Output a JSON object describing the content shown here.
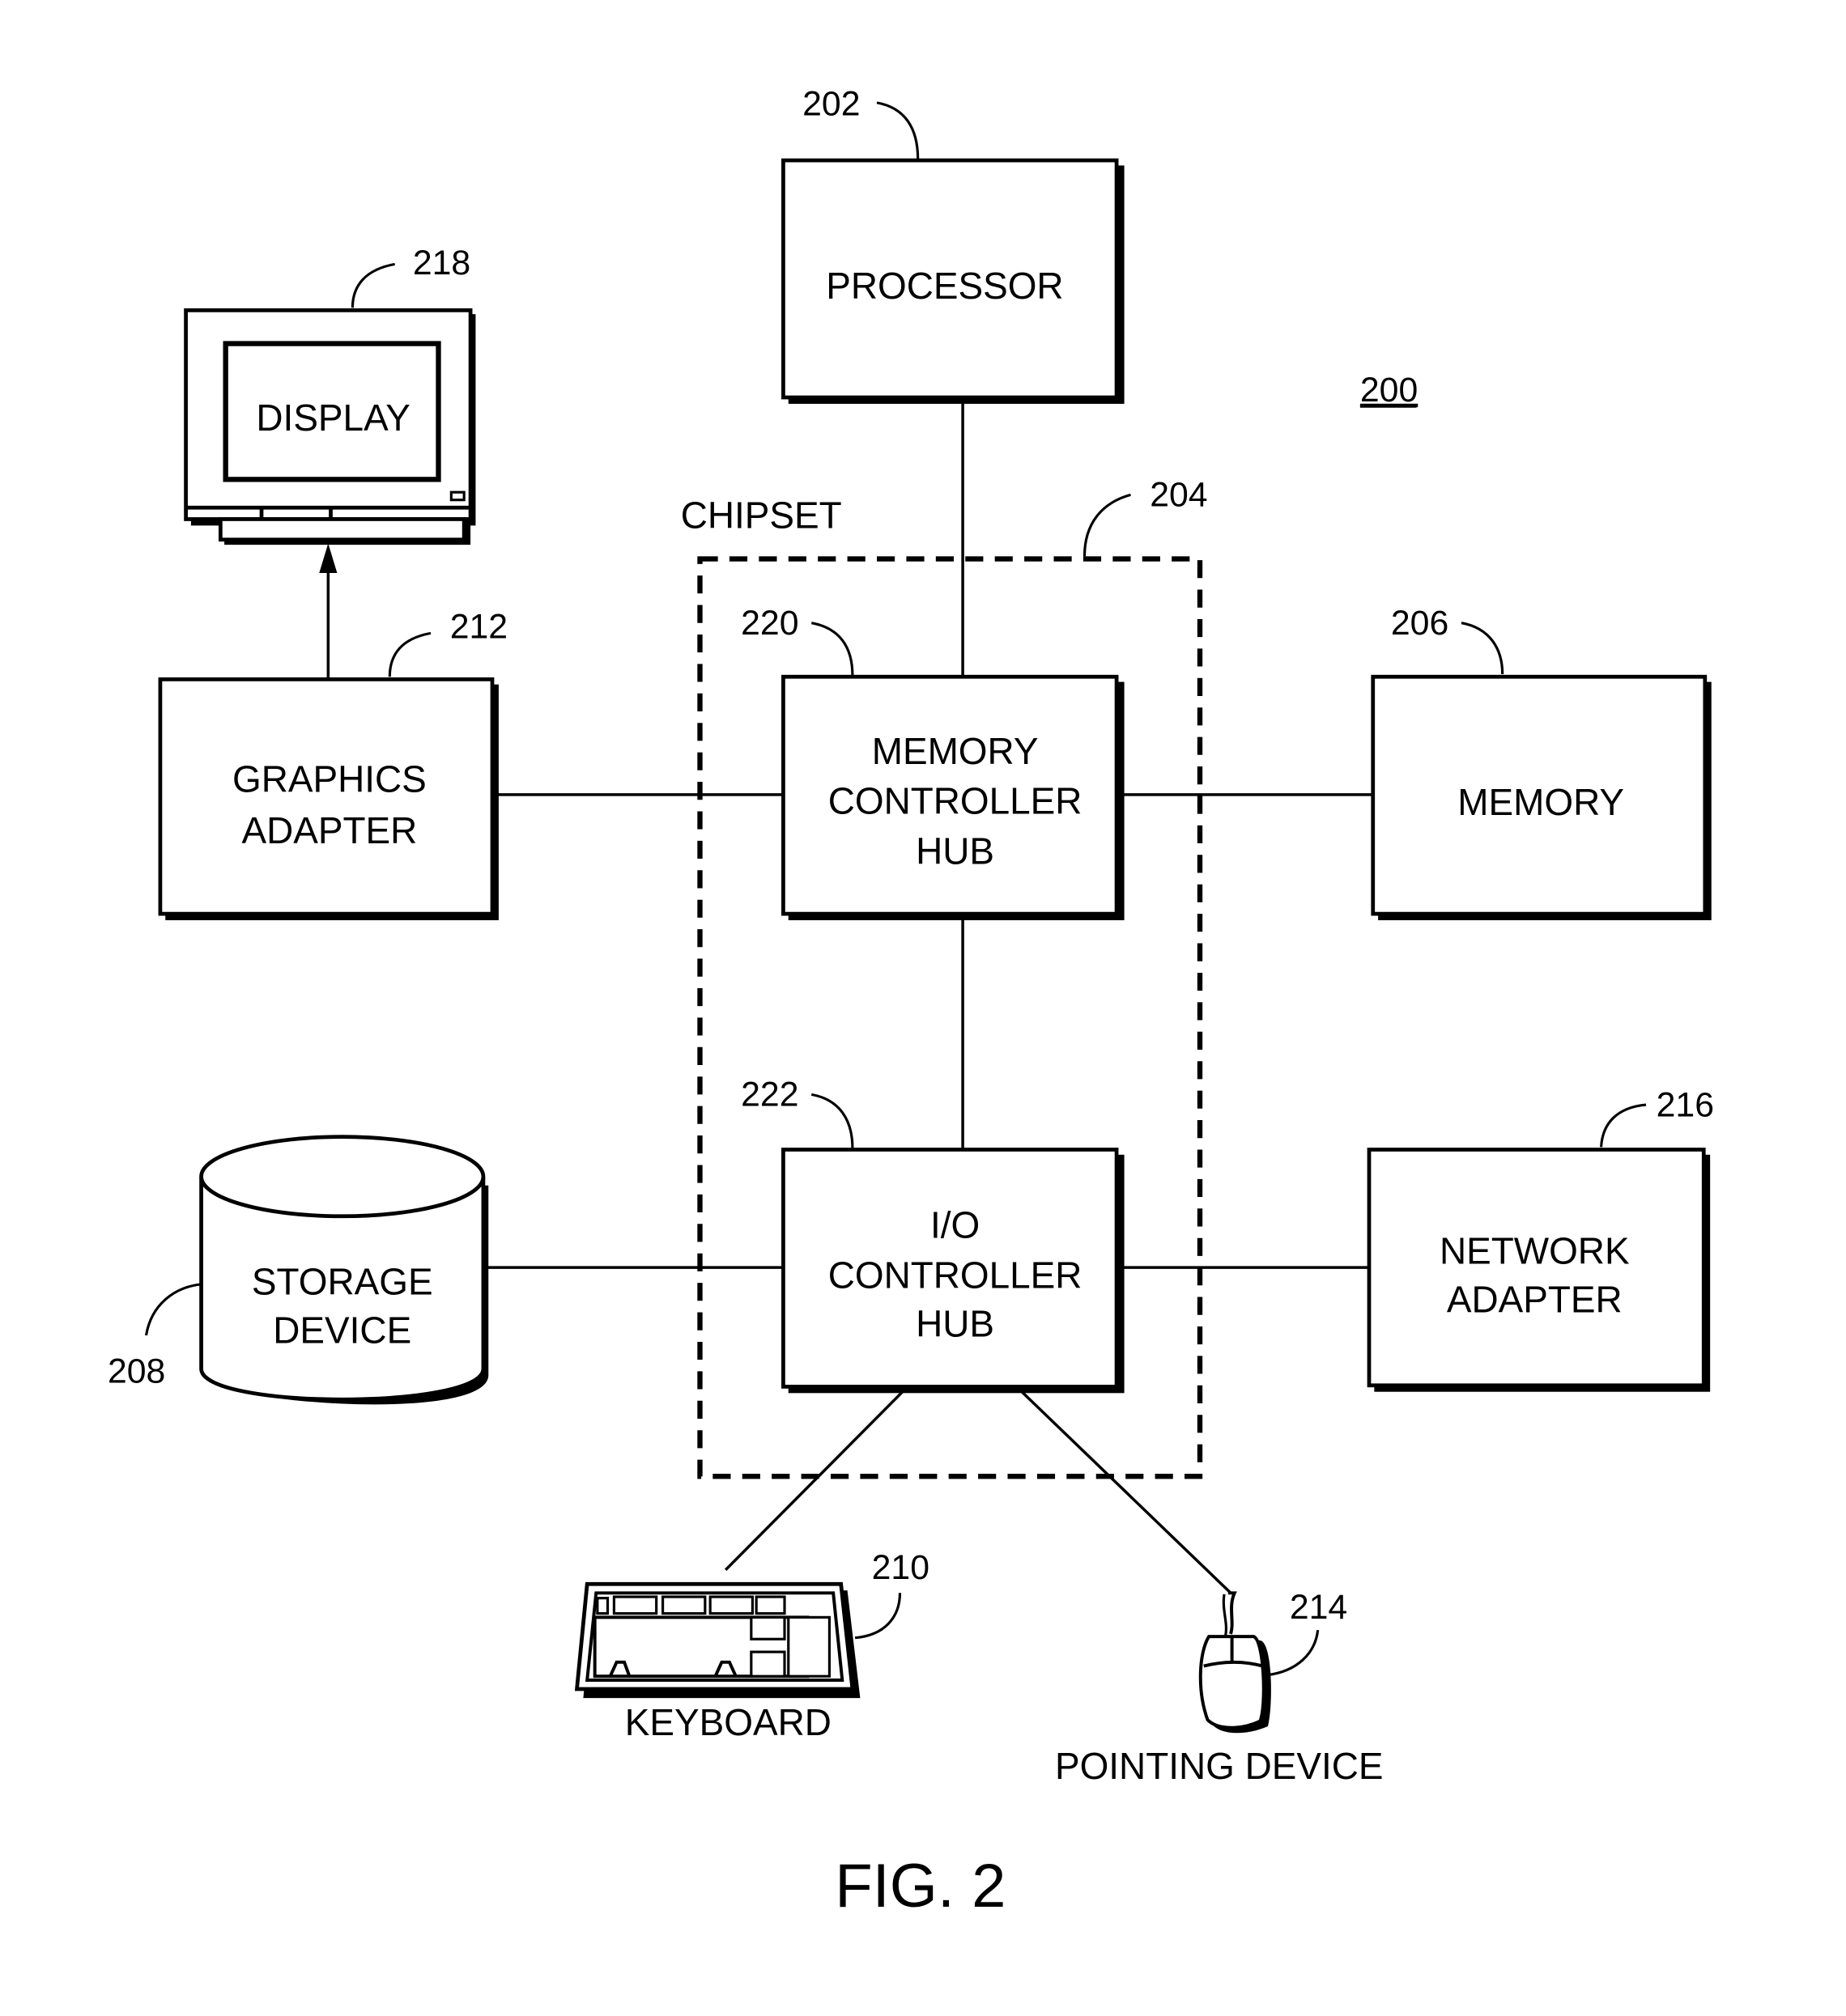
{
  "figure": {
    "caption": "FIG. 2",
    "system_ref": "200"
  },
  "chipset": {
    "label": "CHIPSET",
    "ref": "204"
  },
  "components": {
    "processor": {
      "lines": [
        "PROCESSOR"
      ],
      "ref": "202"
    },
    "memory_controller_hub": {
      "lines": [
        "MEMORY",
        "CONTROLLER",
        "HUB"
      ],
      "ref": "220"
    },
    "memory": {
      "lines": [
        "MEMORY"
      ],
      "ref": "206"
    },
    "graphics_adapter": {
      "lines": [
        "GRAPHICS",
        "ADAPTER"
      ],
      "ref": "212"
    },
    "display": {
      "lines": [
        "DISPLAY"
      ],
      "ref": "218"
    },
    "io_controller_hub": {
      "lines": [
        "I/O",
        "CONTROLLER",
        "HUB"
      ],
      "ref": "222"
    },
    "storage_device": {
      "lines": [
        "STORAGE",
        "DEVICE"
      ],
      "ref": "208"
    },
    "network_adapter": {
      "lines": [
        "NETWORK",
        "ADAPTER"
      ],
      "ref": "216"
    },
    "keyboard": {
      "lines": [
        "KEYBOARD"
      ],
      "ref": "210"
    },
    "pointing_device": {
      "lines": [
        "POINTING DEVICE"
      ],
      "ref": "214"
    }
  },
  "connections": [
    [
      "processor",
      "memory_controller_hub"
    ],
    [
      "graphics_adapter",
      "memory_controller_hub"
    ],
    [
      "memory_controller_hub",
      "memory"
    ],
    [
      "memory_controller_hub",
      "io_controller_hub"
    ],
    [
      "graphics_adapter",
      "display"
    ],
    [
      "storage_device",
      "io_controller_hub"
    ],
    [
      "io_controller_hub",
      "network_adapter"
    ],
    [
      "io_controller_hub",
      "keyboard"
    ],
    [
      "io_controller_hub",
      "pointing_device"
    ]
  ]
}
